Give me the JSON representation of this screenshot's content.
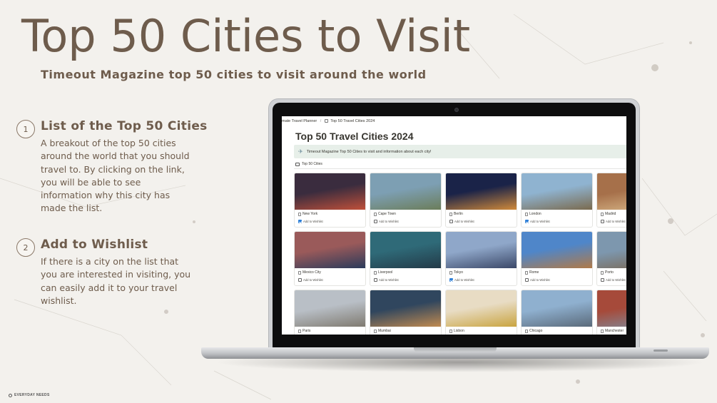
{
  "hero": {
    "title": "Top 50 Cities to Visit",
    "subtitle": "Timeout Magazine top 50 cities to visit around the world"
  },
  "features": [
    {
      "number": "1",
      "heading": "List of the Top 50 Cities",
      "body": "A breakout of the top 50 cities around the world that you should travel to. By clicking on the link, you will be able to see information why this city has made the list."
    },
    {
      "number": "2",
      "heading": "Add to Wishlist",
      "body": "If there is a city on the list that you are interested in visiting, you can easily add it to your travel wishlist."
    }
  ],
  "brand": "EVERYDAY NEEDS",
  "app": {
    "breadcrumb": [
      "mate Travel Planner",
      "Top 50 Travel Cities 2024"
    ],
    "page_title": "Top 50 Travel Cities 2024",
    "callout": "Timeout Magazine Top 50 Cities to visit and information about each city!",
    "view_tab": "Top 50 Cities",
    "wishlist_label": "Add to Wishlist",
    "cards": [
      {
        "name": "New York",
        "checked": true,
        "palette": [
          "#3a2c3e",
          "#c0503a"
        ]
      },
      {
        "name": "Cape Town",
        "checked": false,
        "palette": [
          "#7d9fb3",
          "#6b7d5a"
        ]
      },
      {
        "name": "Berlin",
        "checked": false,
        "palette": [
          "#1a2348",
          "#d08a3a"
        ]
      },
      {
        "name": "London",
        "checked": true,
        "palette": [
          "#8fb3d0",
          "#7a6a4e"
        ]
      },
      {
        "name": "Madrid",
        "checked": false,
        "palette": [
          "#a6704a",
          "#d9b98a"
        ]
      },
      {
        "name": "Mexico City",
        "checked": false,
        "palette": [
          "#9a5a5a",
          "#2a3a5a"
        ]
      },
      {
        "name": "Liverpool",
        "checked": false,
        "palette": [
          "#2f6a78",
          "#233a48"
        ]
      },
      {
        "name": "Tokyo",
        "checked": true,
        "palette": [
          "#8fa7c9",
          "#3b4868"
        ]
      },
      {
        "name": "Rome",
        "checked": false,
        "palette": [
          "#4f86c9",
          "#b07a48"
        ]
      },
      {
        "name": "Porto",
        "checked": false,
        "palette": [
          "#7d97ae",
          "#7a6650"
        ]
      },
      {
        "name": "Paris",
        "checked": false,
        "palette": [
          "#b9bfc6",
          "#7f7a70"
        ]
      },
      {
        "name": "Mumbai",
        "checked": false,
        "palette": [
          "#30465e",
          "#c08a50"
        ]
      },
      {
        "name": "Lisbon",
        "checked": false,
        "palette": [
          "#e8dcc4",
          "#c9a440"
        ]
      },
      {
        "name": "Chicago",
        "checked": false,
        "palette": [
          "#8fb0cf",
          "#5a6a7a"
        ]
      },
      {
        "name": "Manchester",
        "checked": false,
        "palette": [
          "#a64a3a",
          "#7d8ea0"
        ]
      }
    ]
  }
}
